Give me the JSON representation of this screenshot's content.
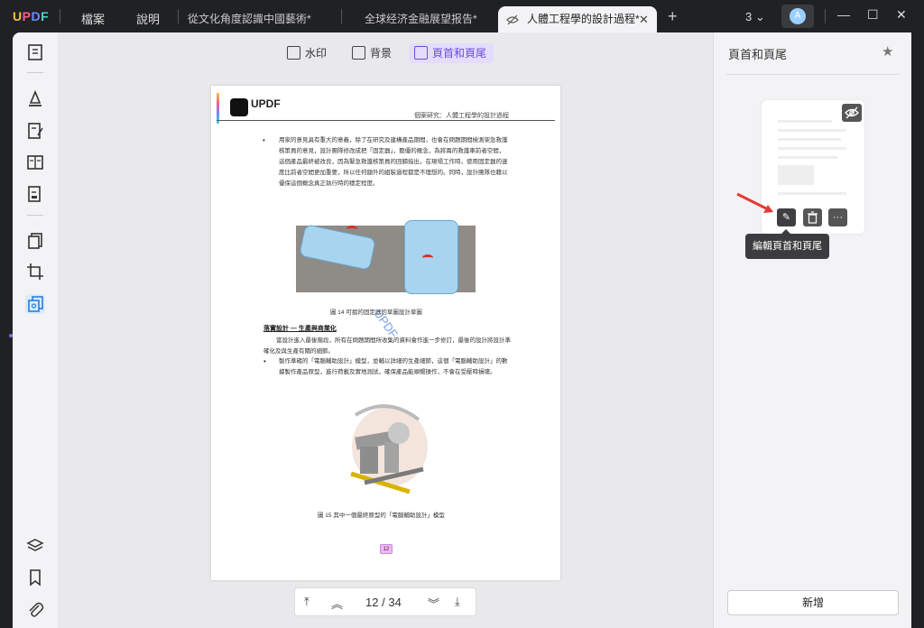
{
  "app": {
    "logo": "UPDF"
  },
  "menu": {
    "file": "檔案",
    "help": "說明"
  },
  "tabs": [
    {
      "label": "從文化角度認識中國藝術*"
    },
    {
      "label": "全球经济金融展望报告*"
    },
    {
      "label": "人體工程學的設計過程*"
    }
  ],
  "window": {
    "count": "3",
    "avatar_initial": "A"
  },
  "toolbar": {
    "watermark": "水印",
    "background": "背景",
    "header_footer": "頁首和頁尾"
  },
  "document": {
    "header_right": "個案研究：人體工程學的設計過程",
    "logo_text": "UPDF",
    "paragraph1": "用家的意見具有重大的意義，除了在研究及建構產品期間，也會在問題期間檢測架急救護核策員的意見，設計團隊修改成把「固定器」，聽優的概念，為將兩的救護車前者空間，這個產品最終被改良，因為緊急救護核策員的回饋指出，在現場工作時，使用固定器的速度比前者空間更加重要，所以任何額外的組裝過程都是不理想的。同時，設計團隊也藉以優保這個概念真正執行時的穩定程度。",
    "caption1": "圖 14 可摺的固定器的草圖設計草圖",
    "section_title": "落實設計 — 生產與商業化",
    "paragraph2": "當設計進入最後階段，所有在問題期間所收集的資料會作進一步修訂，最後的設計將設計準確化及與生產有關的細節。",
    "paragraph3": "製作準確的「電腦輔助設計」模型，並輔以詳細的生產細節，這個「電腦輔助設計」的數據製作產品原型，進行荷載及實地測試，確保產品能順暢操作，不會在受壓時損壞。",
    "caption2": "圖 15 其中一個最終原型的「電腦輔助設計」模型",
    "watermark_text": "UPDF",
    "page_badge": "12"
  },
  "pagenav": {
    "current": "12",
    "separator": "/",
    "total": "34"
  },
  "panel": {
    "title": "頁首和頁尾",
    "tooltip": "編輯頁首和頁尾",
    "add_button": "新增"
  }
}
